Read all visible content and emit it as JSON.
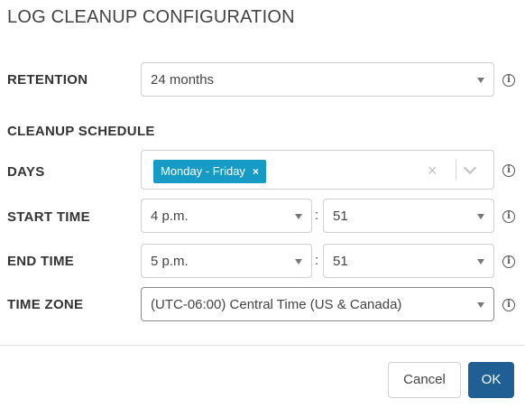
{
  "dialog": {
    "title": "LOG CLEANUP CONFIGURATION"
  },
  "retention": {
    "label": "RETENTION",
    "value": "24 months"
  },
  "schedule": {
    "heading": "CLEANUP SCHEDULE"
  },
  "days": {
    "label": "DAYS",
    "chips": [
      "Monday - Friday"
    ],
    "chip_remove": "×",
    "clear": "×"
  },
  "start_time": {
    "label": "START TIME",
    "hour": "4 p.m.",
    "minute": "51"
  },
  "end_time": {
    "label": "END TIME",
    "hour": "5 p.m.",
    "minute": "51"
  },
  "time_zone": {
    "label": "TIME ZONE",
    "value": "(UTC-06:00) Central Time (US & Canada)"
  },
  "separator": ":",
  "info_glyph": "i",
  "buttons": {
    "cancel": "Cancel",
    "ok": "OK"
  },
  "colors": {
    "chip": "#169bc6",
    "primary": "#1f5f94"
  }
}
